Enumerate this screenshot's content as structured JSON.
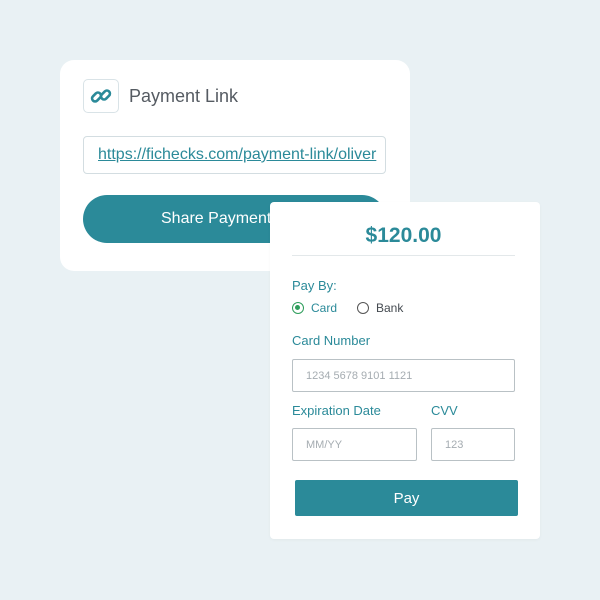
{
  "colors": {
    "background": "#e9f1f4",
    "accent": "#2b8a99",
    "radio_checked": "#2e9d5b",
    "card": "#ffffff"
  },
  "payment_link_card": {
    "icon": "link-icon",
    "title": "Payment Link",
    "url": "https://fichecks.com/payment-link/oliver",
    "share_button_label": "Share Payment"
  },
  "payment_form": {
    "amount": "$120.00",
    "pay_by_label": "Pay By:",
    "methods": [
      {
        "label": "Card",
        "selected": true
      },
      {
        "label": "Bank",
        "selected": false
      }
    ],
    "card_number": {
      "label": "Card Number",
      "placeholder": "1234 5678 9101 1121"
    },
    "expiration": {
      "label": "Expiration Date",
      "placeholder": "MM/YY"
    },
    "cvv": {
      "label": "CVV",
      "placeholder": "123"
    },
    "pay_button_label": "Pay"
  }
}
